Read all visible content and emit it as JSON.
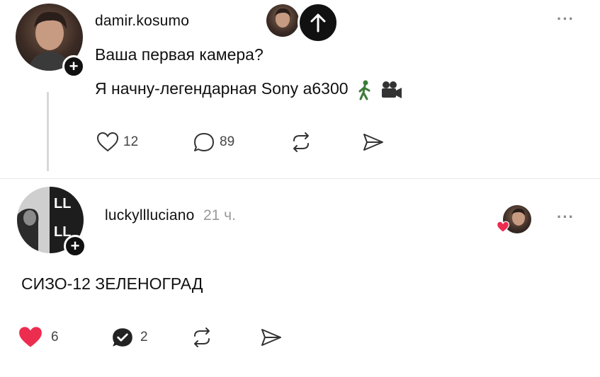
{
  "post": {
    "username": "damir.kosumo",
    "line1": "Ваша первая камера?",
    "line2": "Я начну-легендарная Sony a6300",
    "emoji_names": [
      "person-walking-icon",
      "movie-camera-icon"
    ],
    "likes": "12",
    "comments": "89",
    "more": "···"
  },
  "reply": {
    "username": "luckyllluciano",
    "time": "21 ч.",
    "text": "СИЗО-12 ЗЕЛЕНОГРАД",
    "likes": "6",
    "comments": "2",
    "more": "···"
  },
  "colors": {
    "like_active": "#ec2d4f",
    "text": "#111111",
    "muted": "#9a9a9a"
  }
}
